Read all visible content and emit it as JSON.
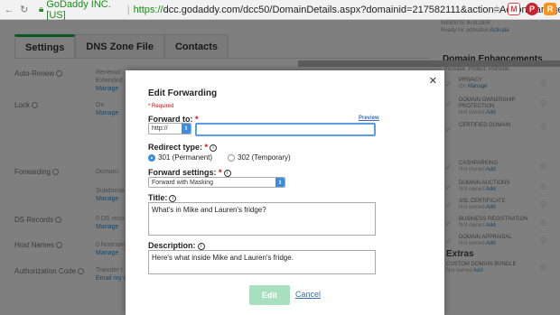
{
  "browser": {
    "secure_label": "GoDaddy INC. [US]",
    "url_scheme": "https://",
    "url_rest": "dcc.godaddy.com/dcc50/DomainDetails.aspx?domainid=217582111&action=ActionManageForwarding"
  },
  "tabs": [
    {
      "label": "Settings"
    },
    {
      "label": "DNS Zone File"
    },
    {
      "label": "Contacts"
    }
  ],
  "settings_rows": {
    "auto_renew": {
      "label": "Auto-Renew",
      "value": "Renewal:",
      "value2": "Extended",
      "link": "Manage"
    },
    "lock": {
      "label": "Lock",
      "value": "On",
      "link": "Manage"
    },
    "forwarding": {
      "label": "Forwarding",
      "value": "Domain:",
      "value2": "Subdomai",
      "link": "Manage"
    },
    "ds_records": {
      "label": "DS Records",
      "value": "0 DS reco",
      "link": "Manage"
    },
    "host_names": {
      "label": "Host Names",
      "value": "0 hostnam",
      "link": "Manage"
    },
    "auth_code": {
      "label": "Authorization Code",
      "value": "Transfer t",
      "link": "Email my co"
    }
  },
  "sidebar": {
    "top_text": "WEBSITE BUILDER",
    "top_text2": "Ready for activation",
    "top_link": "Activate",
    "title": "Domain Enhancements",
    "subtitle": "Increase. Protect. Promote.",
    "items": [
      {
        "name": "PRIVACY",
        "status": "On",
        "link": "Manage"
      },
      {
        "name": "DOMAIN OWNERSHIP PROTECTION",
        "status": "Not owned",
        "link": "Add"
      },
      {
        "name": "CERTIFIED DOMAIN",
        "status": "",
        "link": ""
      },
      {
        "name": "CASHPARKING",
        "status": "Not owned",
        "link": "Add"
      },
      {
        "name": "DOMAIN AUCTIONS",
        "status": "Not owned",
        "link": "Add"
      },
      {
        "name": "SSL CERTIFICATE",
        "status": "Not owned",
        "link": "Add"
      },
      {
        "name": "BUSINESS REGISTRATION",
        "status": "Not owned",
        "link": "Add"
      },
      {
        "name": "DOMAIN APPRAISAL",
        "status": "Not owned",
        "link": "Add"
      },
      {
        "name": "CUSTOM DOMAIN BUNDLE",
        "status": "Not owned",
        "link": "Add"
      }
    ],
    "extras": "Extras"
  },
  "modal": {
    "title": "Edit Forwarding",
    "required_note": "* Required",
    "forward_to_label": "Forward to:",
    "preview_link": "Preview",
    "protocol_value": "http://",
    "forward_to_value": "",
    "redirect_label": "Redirect type:",
    "redirect_options": [
      {
        "label": "301 (Permanent)",
        "selected": true
      },
      {
        "label": "302 (Temporary)",
        "selected": false
      }
    ],
    "settings_label": "Forward settings:",
    "settings_value": "Forward with Masking",
    "title_label": "Title:",
    "title_value": "What's in Mike and Lauren's fridge?",
    "description_label": "Description:",
    "description_value": "Here's what inside Mike and Lauren's fridge.",
    "edit_button": "Edit",
    "cancel_link": "Cancel"
  },
  "colors": {
    "accent_green": "#1bae4a",
    "link_blue": "#3a6fb0",
    "select_blue": "#3b8de0"
  }
}
